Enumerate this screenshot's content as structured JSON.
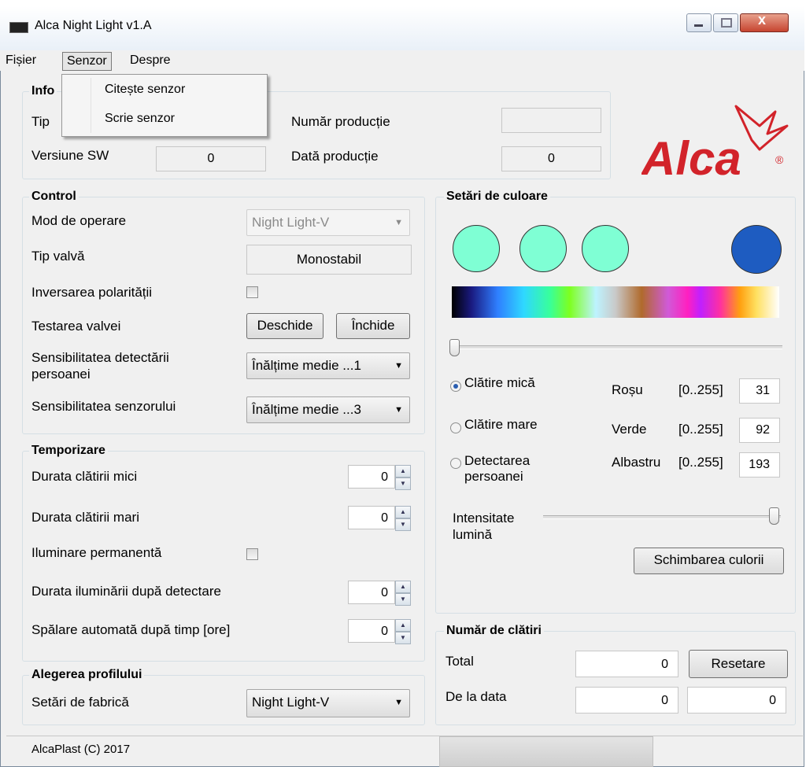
{
  "window": {
    "title": "Alca Night Light  v1.A"
  },
  "menu": {
    "items": [
      "Fișier",
      "Senzor",
      "Despre"
    ],
    "dropdown": [
      "Citește senzor",
      "Scrie senzor"
    ]
  },
  "info": {
    "heading": "Info",
    "tip_label": "Tip",
    "version_label": "Versiune SW",
    "version_value": "0",
    "production_number_label": "Număr producție",
    "production_number_value": "",
    "production_date_label": "Dată producție",
    "production_date_value": "0"
  },
  "logo": {
    "text": "Alca",
    "mark": "®"
  },
  "control": {
    "heading": "Control",
    "mode_label": "Mod de operare",
    "mode_value": "Night Light-V",
    "valve_type_label": "Tip valvă",
    "valve_type_value": "Monostabil",
    "polarity_label": "Inversarea polarității",
    "test_label": "Testarea valvei",
    "open_button": "Deschide",
    "close_button": "Închide",
    "person_sens_label": "Sensibilitatea detectării persoanei",
    "person_sens_value": "Înălțime medie ...1",
    "sensor_sens_label": "Sensibilitatea senzorului",
    "sensor_sens_value": "Înălțime medie ...3"
  },
  "timing": {
    "heading": "Temporizare",
    "small_rinse_label": "Durata clătirii mici",
    "small_rinse_value": "0",
    "big_rinse_label": "Durata clătirii mari",
    "big_rinse_value": "0",
    "permanent_light_label": "Iluminare permanentă",
    "light_after_label": "Durata iluminării după detectare",
    "light_after_value": "0",
    "auto_wash_label": "Spălare automată după timp [ore]",
    "auto_wash_value": "0"
  },
  "profile": {
    "heading": "Alegerea profilului",
    "factory_label": "Setări de fabrică",
    "factory_value": "Night Light-V"
  },
  "colors": {
    "heading": "Setări de culoare",
    "swatches": [
      "#7fffd4",
      "#7fffd4",
      "#7fffd4",
      "#1e5cc1"
    ],
    "radio_small": "Clătire mică",
    "radio_big": "Clătire mare",
    "radio_detect": "Detectarea persoanei",
    "selected_radio": "Clătire mică",
    "red_label": "Roșu",
    "red_range": "[0..255]",
    "red_value": "31",
    "green_label": "Verde",
    "green_range": "[0..255]",
    "green_value": "92",
    "blue_label": "Albastru",
    "blue_range": "[0..255]",
    "blue_value": "193",
    "intensity_label": "Intensitate lumină",
    "hue_slider_position": 0,
    "intensity_slider_position": 1,
    "change_button": "Schimbarea culorii"
  },
  "rinses": {
    "heading": "Număr de clătiri",
    "total_label": "Total",
    "total_value": "0",
    "reset_button": "Resetare",
    "since_label": "De la data",
    "since_value": "0",
    "since_date": "0"
  },
  "status": {
    "text": "AlcaPlast  (C) 2017"
  }
}
